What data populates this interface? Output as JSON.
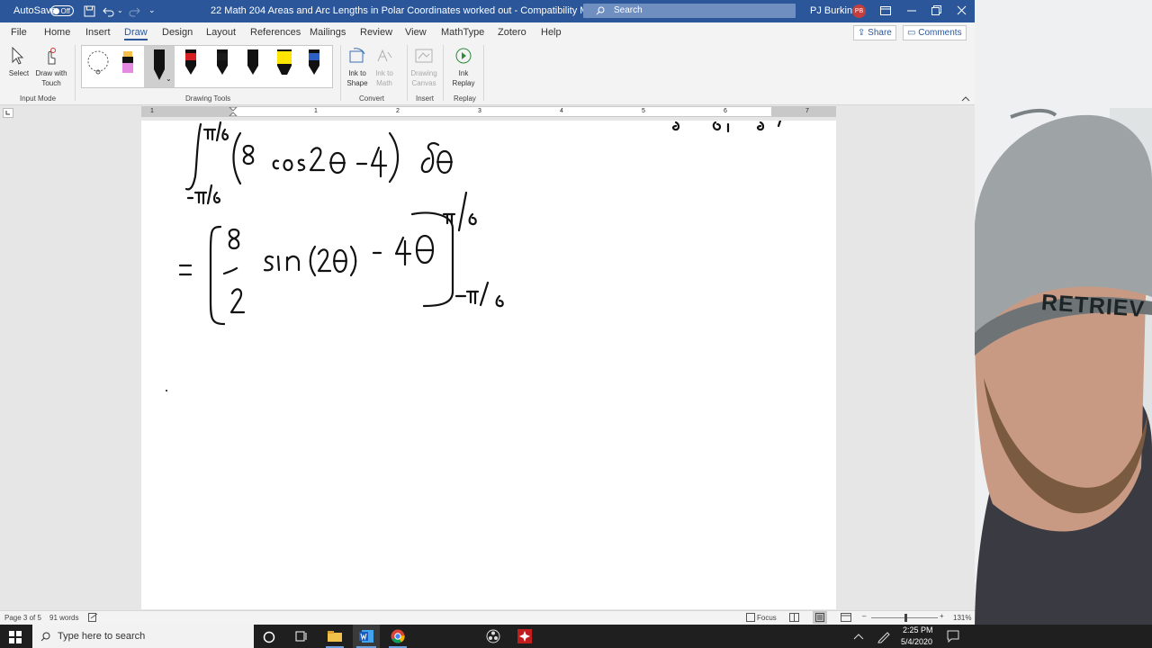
{
  "titlebar": {
    "autosave_label": "AutoSave",
    "autosave_state": "Off",
    "doc_title": "22 Math 204 Areas and Arc Lengths in Polar Coordinates worked out  -  Compatibility M...",
    "search_placeholder": "Search",
    "user_name": "PJ Burkins",
    "user_initials": "PB"
  },
  "menu": {
    "items": [
      "File",
      "Home",
      "Insert",
      "Draw",
      "Design",
      "Layout",
      "References",
      "Mailings",
      "Review",
      "View",
      "MathType",
      "Zotero",
      "Help"
    ],
    "active": "Draw",
    "share_label": "Share",
    "comments_label": "Comments"
  },
  "ribbon": {
    "select_label": "Select",
    "draw_touch_label": "Draw with Touch",
    "input_mode_group": "Input Mode",
    "drawing_tools_group": "Drawing Tools",
    "ink_to_shape_label": "Ink to Shape",
    "ink_to_math_label": "Ink to Math",
    "convert_group": "Convert",
    "drawing_canvas_label": "Drawing Canvas",
    "insert_group": "Insert",
    "ink_replay_label": "Ink Replay",
    "replay_group": "Replay",
    "pen_colors": [
      "#111111",
      "#111111",
      "#d42020",
      "#1a1a1a",
      "#111111",
      "#ffe600",
      "#2d5fc4"
    ]
  },
  "ruler": {
    "numbers": [
      "1",
      "1",
      "2",
      "3",
      "4",
      "5",
      "6",
      "7"
    ]
  },
  "status": {
    "page": "Page 3 of 5",
    "words": "91 words",
    "focus": "Focus",
    "zoom": "131%"
  },
  "taskbar": {
    "search_text": "Type here to search",
    "time": "2:25 PM",
    "date": "5/4/2020"
  },
  "webcam": {
    "cap_text": "RETRIEV"
  }
}
